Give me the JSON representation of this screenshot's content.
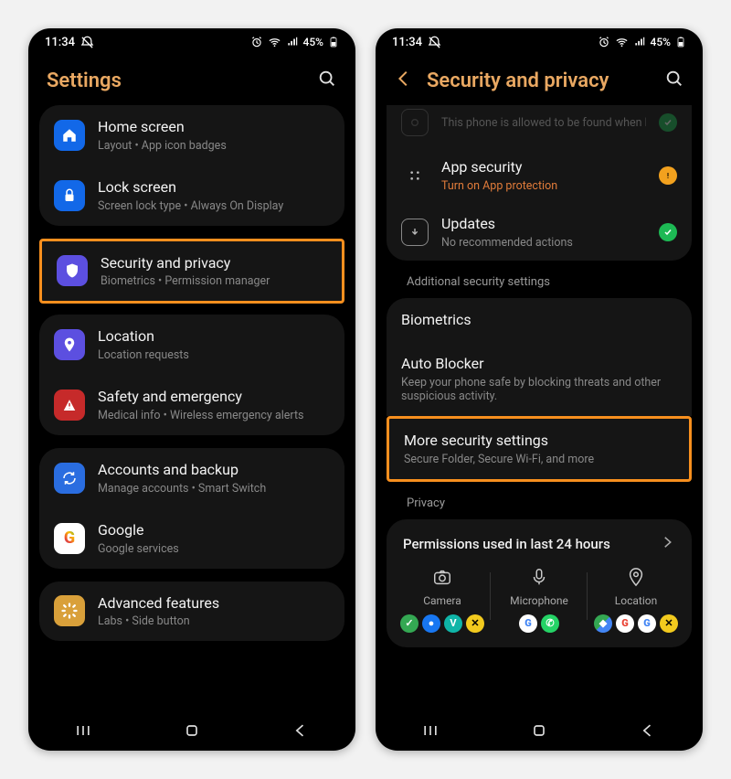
{
  "status": {
    "time": "11:34",
    "battery_pct": "45%"
  },
  "left": {
    "title": "Settings",
    "items": [
      {
        "title": "Home screen",
        "sub": "Layout  •  App icon badges",
        "icon": "home-icon",
        "bg": "#1268e8"
      },
      {
        "title": "Lock screen",
        "sub": "Screen lock type  •  Always On Display",
        "icon": "lock-icon",
        "bg": "#1268e8"
      },
      {
        "title": "Security and privacy",
        "sub": "Biometrics  •  Permission manager",
        "icon": "shield-icon",
        "bg": "#5c4fe0",
        "highlight": true
      },
      {
        "title": "Location",
        "sub": "Location requests",
        "icon": "pin-icon",
        "bg": "#5c4fe0"
      },
      {
        "title": "Safety and emergency",
        "sub": "Medical info  •  Wireless emergency alerts",
        "icon": "alert-icon",
        "bg": "#c62a2a"
      },
      {
        "title": "Accounts and backup",
        "sub": "Manage accounts  •  Smart Switch",
        "icon": "sync-icon",
        "bg": "#2a6de0"
      },
      {
        "title": "Google",
        "sub": "Google services",
        "icon": "google-icon",
        "bg": "#ffffff"
      },
      {
        "title": "Advanced features",
        "sub": "Labs  •  Side button",
        "icon": "gear-icon",
        "bg": "#d9a03a"
      }
    ]
  },
  "right": {
    "title": "Security and privacy",
    "top_cut": "This phone is allowed to be found when lost",
    "app_security": {
      "title": "App security",
      "sub": "Turn on App protection"
    },
    "updates": {
      "title": "Updates",
      "sub": "No recommended actions"
    },
    "section1": "Additional security settings",
    "biometrics": "Biometrics",
    "autoblocker": {
      "title": "Auto Blocker",
      "sub": "Keep your phone safe by blocking threats and other suspicious activity."
    },
    "more": {
      "title": "More security settings",
      "sub": "Secure Folder, Secure Wi-Fi, and more"
    },
    "section2": "Privacy",
    "perm_title": "Permissions used in last 24 hours",
    "perm_cols": [
      "Camera",
      "Microphone",
      "Location"
    ]
  },
  "colors": {
    "google_blue": "#4285F4",
    "google_green": "#34A853",
    "whatsapp": "#25D366",
    "yellow": "#f2ca1e",
    "vivid": "#0fb5a8",
    "orange": "#ff7a00",
    "maps_red": "#ea4335"
  }
}
